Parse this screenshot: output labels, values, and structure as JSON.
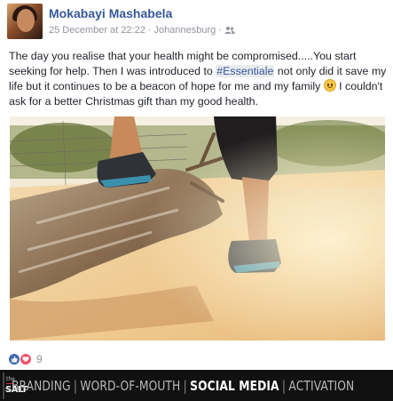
{
  "post": {
    "author": "Mokabayi Mashabela",
    "timestamp": "25 December at 22:22",
    "separator": "·",
    "location": "Johannesburg",
    "separator2": "·",
    "audience_icon": "friends-icon",
    "text_before": "The day you realise that your health might be compromised.....You start seeking for help. Then I was introduced to ",
    "hashtag": "#Essentiale",
    "text_after": " not only did it save my life but it continues to be a beacon of hope for me and my family ",
    "text_end": " I couldn't ask for a better Christmas gift than my good health.",
    "emoji": "smiling-face-emoji"
  },
  "reactions": {
    "icons": [
      "like-reaction-icon",
      "love-reaction-icon"
    ],
    "count": "9"
  },
  "banner": {
    "logo_small": "the",
    "logo_word": "SALT",
    "items": [
      "BRANDING",
      "WORD-OF-MOUTH",
      "SOCIAL MEDIA",
      "ACTIVATION"
    ],
    "separator": "|",
    "highlighted_item": "SOCIAL MEDIA"
  },
  "colors": {
    "link": "#365899",
    "meta": "#90949c",
    "like": "#4267b2",
    "love": "#f25268",
    "banner_bg": "#111111"
  }
}
